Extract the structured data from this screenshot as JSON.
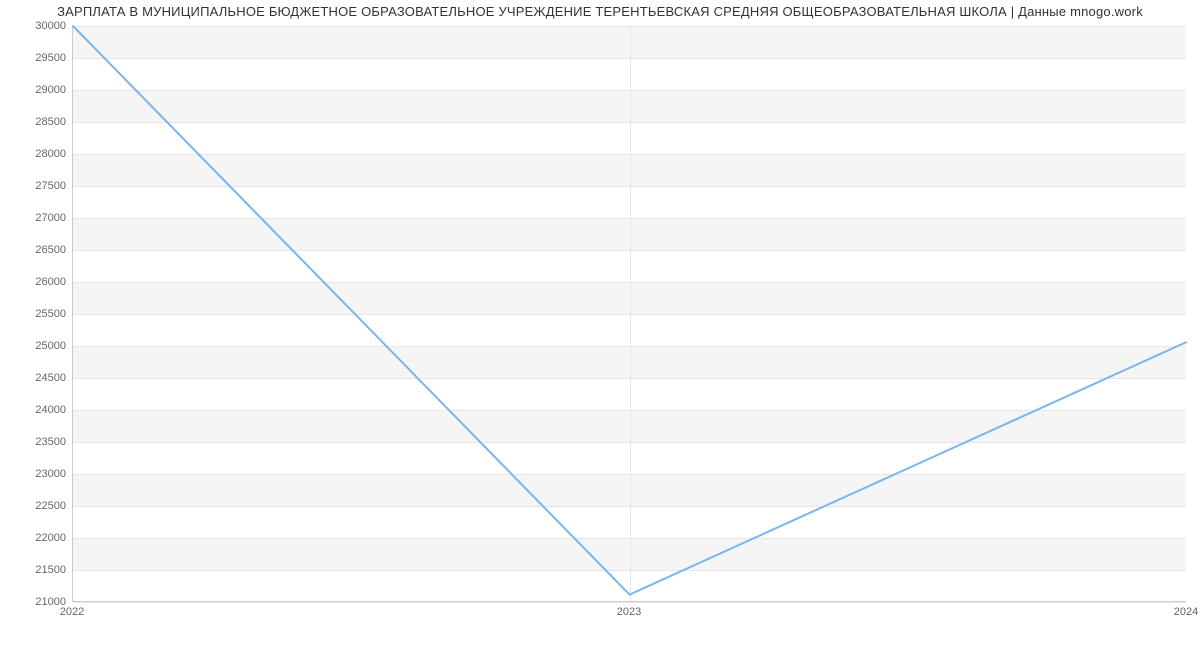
{
  "chart_data": {
    "type": "line",
    "title": "ЗАРПЛАТА В МУНИЦИПАЛЬНОЕ БЮДЖЕТНОЕ ОБРАЗОВАТЕЛЬНОЕ УЧРЕЖДЕНИЕ  ТЕРЕНТЬЕВСКАЯ СРЕДНЯЯ ОБЩЕОБРАЗОВАТЕЛЬНАЯ ШКОЛА | Данные mnogo.work",
    "x": [
      2022,
      2023,
      2024
    ],
    "values": [
      30000,
      21100,
      25050
    ],
    "xlabel": "",
    "ylabel": "",
    "ylim": [
      21000,
      30000
    ],
    "y_ticks": [
      21000,
      21500,
      22000,
      22500,
      23000,
      23500,
      24000,
      24500,
      25000,
      25500,
      26000,
      26500,
      27000,
      27500,
      28000,
      28500,
      29000,
      29500,
      30000
    ],
    "x_ticks": [
      2022,
      2023,
      2024
    ],
    "series_color": "#7cb5ec"
  }
}
